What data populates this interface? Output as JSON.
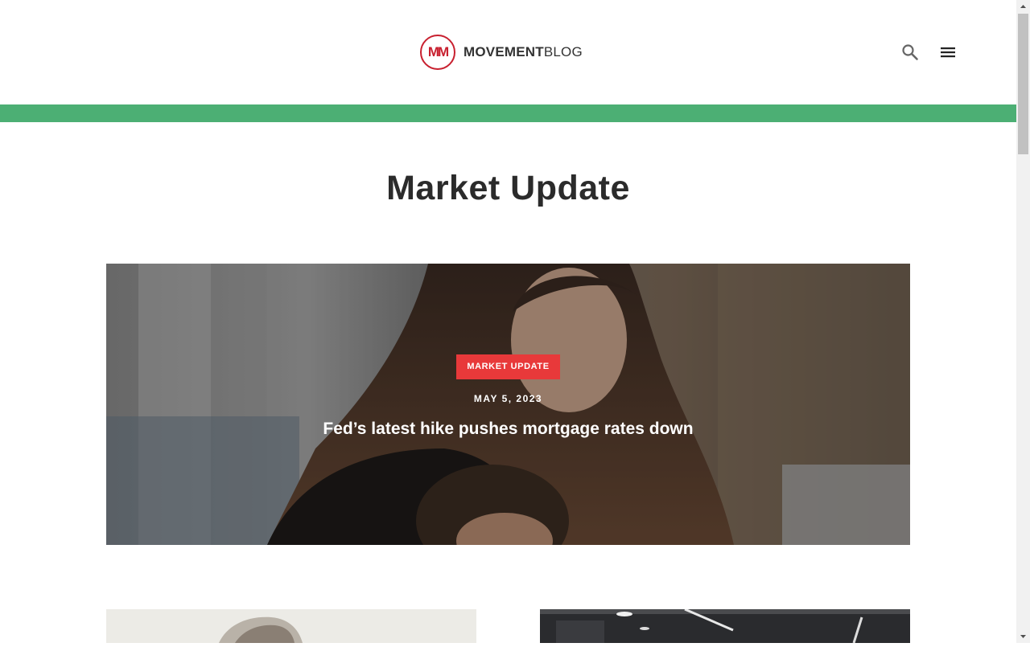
{
  "header": {
    "logo_mark": "MM",
    "logo_bold": "MOVEMENT",
    "logo_light": "BLOG",
    "search_icon": "search-icon",
    "menu_icon": "hamburger-menu-icon"
  },
  "colors": {
    "brand_red": "#c8202f",
    "accent_green": "#4caf74",
    "badge_red": "#e8393a",
    "title_text": "#2b2b2b"
  },
  "page": {
    "title": "Market Update"
  },
  "hero": {
    "badge": "MARKET UPDATE",
    "date": "MAY 5, 2023",
    "title": "Fed’s latest hike pushes mortgage rates down",
    "image": "woman-with-child-photo"
  },
  "cards": [
    {
      "image": "woman-portrait-photo"
    },
    {
      "image": "office-interior-photo"
    }
  ]
}
